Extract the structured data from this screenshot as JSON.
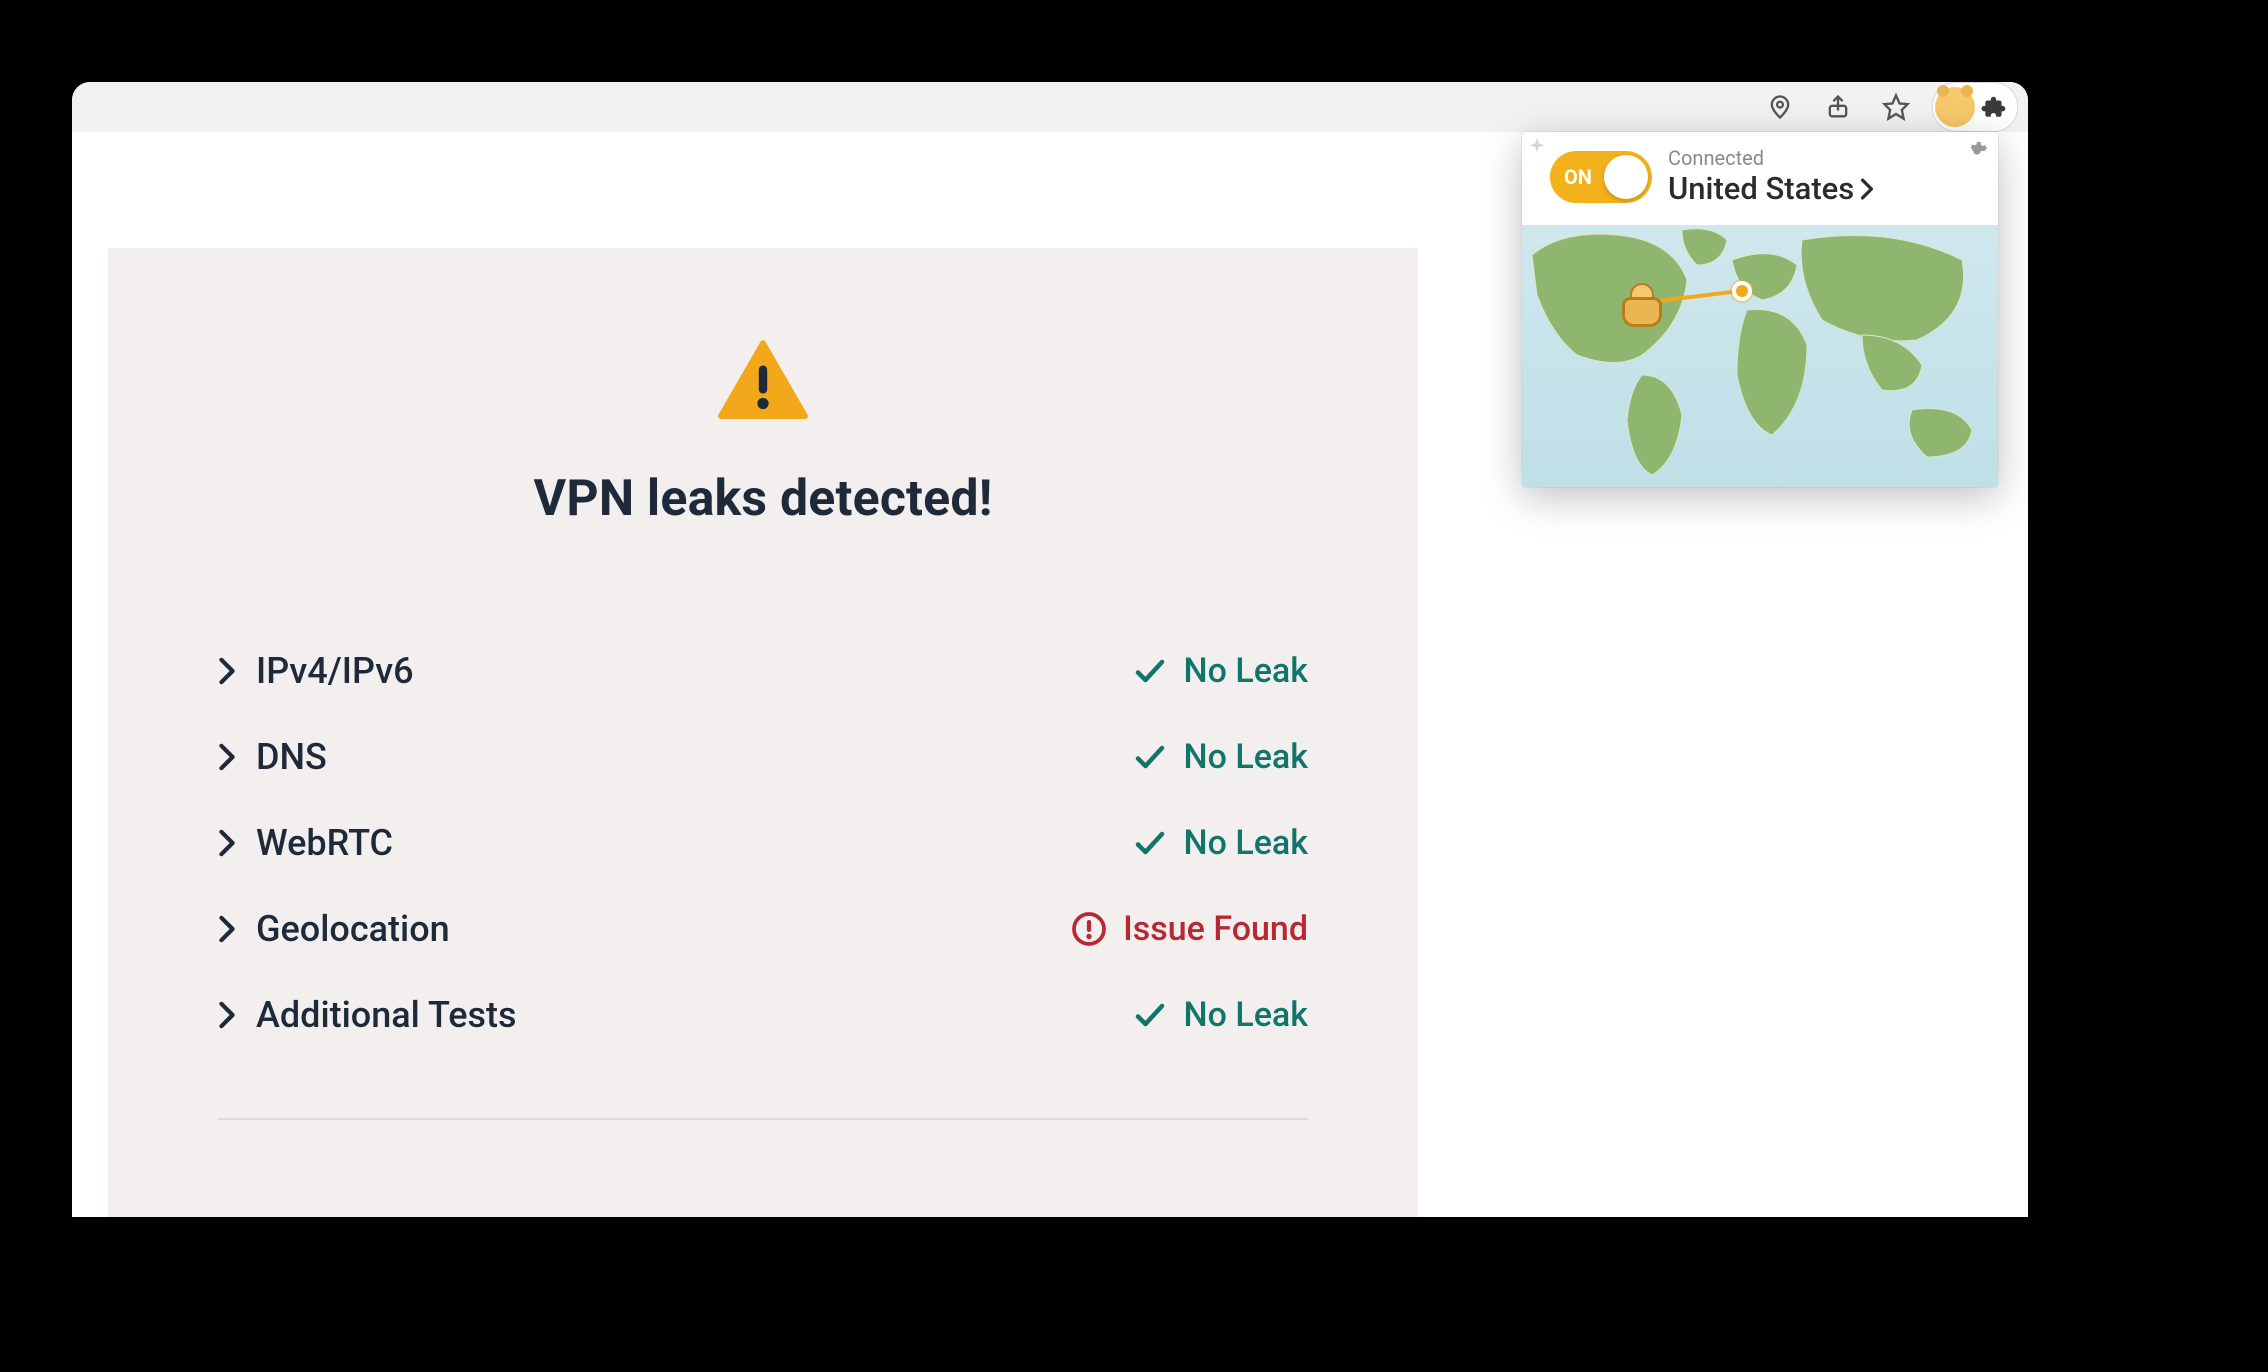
{
  "browser": {
    "icons": {
      "location": "location-icon",
      "share": "share-icon",
      "star": "star-icon",
      "extension_bear": "extension-bear-icon",
      "extensions_puzzle": "extensions-icon"
    }
  },
  "page": {
    "title": "VPN leaks detected!",
    "warning_icon": "warning-triangle-icon",
    "tests": [
      {
        "name": "IPv4/IPv6",
        "status_label": "No Leak",
        "status": "ok"
      },
      {
        "name": "DNS",
        "status_label": "No Leak",
        "status": "ok"
      },
      {
        "name": "WebRTC",
        "status_label": "No Leak",
        "status": "ok"
      },
      {
        "name": "Geolocation",
        "status_label": "Issue Found",
        "status": "issue"
      },
      {
        "name": "Additional Tests",
        "status_label": "No Leak",
        "status": "ok"
      }
    ]
  },
  "popup": {
    "toggle_label": "ON",
    "status_label": "Connected",
    "location": "United States",
    "settings_icon": "gear-icon",
    "map_icon": "world-map"
  },
  "colors": {
    "accent": "#f3b21b",
    "ok": "#10756a",
    "issue": "#b82832",
    "text": "#1e2a3a"
  }
}
